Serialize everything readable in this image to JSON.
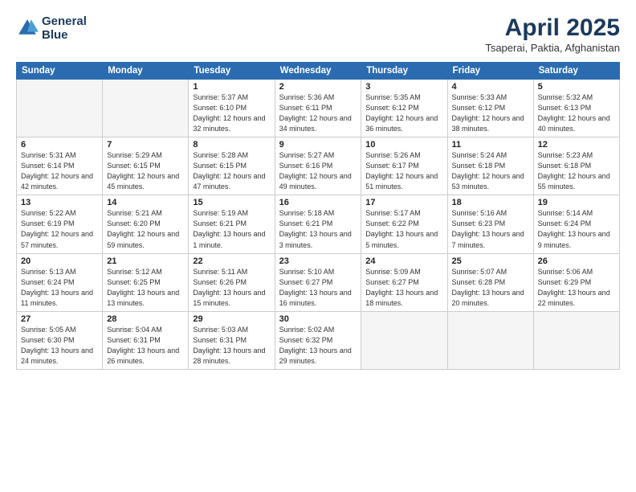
{
  "header": {
    "logo_line1": "General",
    "logo_line2": "Blue",
    "month_title": "April 2025",
    "location": "Tsaperai, Paktia, Afghanistan"
  },
  "days_of_week": [
    "Sunday",
    "Monday",
    "Tuesday",
    "Wednesday",
    "Thursday",
    "Friday",
    "Saturday"
  ],
  "weeks": [
    [
      {
        "day": "",
        "sunrise": "",
        "sunset": "",
        "daylight": ""
      },
      {
        "day": "",
        "sunrise": "",
        "sunset": "",
        "daylight": ""
      },
      {
        "day": "1",
        "sunrise": "Sunrise: 5:37 AM",
        "sunset": "Sunset: 6:10 PM",
        "daylight": "Daylight: 12 hours and 32 minutes."
      },
      {
        "day": "2",
        "sunrise": "Sunrise: 5:36 AM",
        "sunset": "Sunset: 6:11 PM",
        "daylight": "Daylight: 12 hours and 34 minutes."
      },
      {
        "day": "3",
        "sunrise": "Sunrise: 5:35 AM",
        "sunset": "Sunset: 6:12 PM",
        "daylight": "Daylight: 12 hours and 36 minutes."
      },
      {
        "day": "4",
        "sunrise": "Sunrise: 5:33 AM",
        "sunset": "Sunset: 6:12 PM",
        "daylight": "Daylight: 12 hours and 38 minutes."
      },
      {
        "day": "5",
        "sunrise": "Sunrise: 5:32 AM",
        "sunset": "Sunset: 6:13 PM",
        "daylight": "Daylight: 12 hours and 40 minutes."
      }
    ],
    [
      {
        "day": "6",
        "sunrise": "Sunrise: 5:31 AM",
        "sunset": "Sunset: 6:14 PM",
        "daylight": "Daylight: 12 hours and 42 minutes."
      },
      {
        "day": "7",
        "sunrise": "Sunrise: 5:29 AM",
        "sunset": "Sunset: 6:15 PM",
        "daylight": "Daylight: 12 hours and 45 minutes."
      },
      {
        "day": "8",
        "sunrise": "Sunrise: 5:28 AM",
        "sunset": "Sunset: 6:15 PM",
        "daylight": "Daylight: 12 hours and 47 minutes."
      },
      {
        "day": "9",
        "sunrise": "Sunrise: 5:27 AM",
        "sunset": "Sunset: 6:16 PM",
        "daylight": "Daylight: 12 hours and 49 minutes."
      },
      {
        "day": "10",
        "sunrise": "Sunrise: 5:26 AM",
        "sunset": "Sunset: 6:17 PM",
        "daylight": "Daylight: 12 hours and 51 minutes."
      },
      {
        "day": "11",
        "sunrise": "Sunrise: 5:24 AM",
        "sunset": "Sunset: 6:18 PM",
        "daylight": "Daylight: 12 hours and 53 minutes."
      },
      {
        "day": "12",
        "sunrise": "Sunrise: 5:23 AM",
        "sunset": "Sunset: 6:18 PM",
        "daylight": "Daylight: 12 hours and 55 minutes."
      }
    ],
    [
      {
        "day": "13",
        "sunrise": "Sunrise: 5:22 AM",
        "sunset": "Sunset: 6:19 PM",
        "daylight": "Daylight: 12 hours and 57 minutes."
      },
      {
        "day": "14",
        "sunrise": "Sunrise: 5:21 AM",
        "sunset": "Sunset: 6:20 PM",
        "daylight": "Daylight: 12 hours and 59 minutes."
      },
      {
        "day": "15",
        "sunrise": "Sunrise: 5:19 AM",
        "sunset": "Sunset: 6:21 PM",
        "daylight": "Daylight: 13 hours and 1 minute."
      },
      {
        "day": "16",
        "sunrise": "Sunrise: 5:18 AM",
        "sunset": "Sunset: 6:21 PM",
        "daylight": "Daylight: 13 hours and 3 minutes."
      },
      {
        "day": "17",
        "sunrise": "Sunrise: 5:17 AM",
        "sunset": "Sunset: 6:22 PM",
        "daylight": "Daylight: 13 hours and 5 minutes."
      },
      {
        "day": "18",
        "sunrise": "Sunrise: 5:16 AM",
        "sunset": "Sunset: 6:23 PM",
        "daylight": "Daylight: 13 hours and 7 minutes."
      },
      {
        "day": "19",
        "sunrise": "Sunrise: 5:14 AM",
        "sunset": "Sunset: 6:24 PM",
        "daylight": "Daylight: 13 hours and 9 minutes."
      }
    ],
    [
      {
        "day": "20",
        "sunrise": "Sunrise: 5:13 AM",
        "sunset": "Sunset: 6:24 PM",
        "daylight": "Daylight: 13 hours and 11 minutes."
      },
      {
        "day": "21",
        "sunrise": "Sunrise: 5:12 AM",
        "sunset": "Sunset: 6:25 PM",
        "daylight": "Daylight: 13 hours and 13 minutes."
      },
      {
        "day": "22",
        "sunrise": "Sunrise: 5:11 AM",
        "sunset": "Sunset: 6:26 PM",
        "daylight": "Daylight: 13 hours and 15 minutes."
      },
      {
        "day": "23",
        "sunrise": "Sunrise: 5:10 AM",
        "sunset": "Sunset: 6:27 PM",
        "daylight": "Daylight: 13 hours and 16 minutes."
      },
      {
        "day": "24",
        "sunrise": "Sunrise: 5:09 AM",
        "sunset": "Sunset: 6:27 PM",
        "daylight": "Daylight: 13 hours and 18 minutes."
      },
      {
        "day": "25",
        "sunrise": "Sunrise: 5:07 AM",
        "sunset": "Sunset: 6:28 PM",
        "daylight": "Daylight: 13 hours and 20 minutes."
      },
      {
        "day": "26",
        "sunrise": "Sunrise: 5:06 AM",
        "sunset": "Sunset: 6:29 PM",
        "daylight": "Daylight: 13 hours and 22 minutes."
      }
    ],
    [
      {
        "day": "27",
        "sunrise": "Sunrise: 5:05 AM",
        "sunset": "Sunset: 6:30 PM",
        "daylight": "Daylight: 13 hours and 24 minutes."
      },
      {
        "day": "28",
        "sunrise": "Sunrise: 5:04 AM",
        "sunset": "Sunset: 6:31 PM",
        "daylight": "Daylight: 13 hours and 26 minutes."
      },
      {
        "day": "29",
        "sunrise": "Sunrise: 5:03 AM",
        "sunset": "Sunset: 6:31 PM",
        "daylight": "Daylight: 13 hours and 28 minutes."
      },
      {
        "day": "30",
        "sunrise": "Sunrise: 5:02 AM",
        "sunset": "Sunset: 6:32 PM",
        "daylight": "Daylight: 13 hours and 29 minutes."
      },
      {
        "day": "",
        "sunrise": "",
        "sunset": "",
        "daylight": ""
      },
      {
        "day": "",
        "sunrise": "",
        "sunset": "",
        "daylight": ""
      },
      {
        "day": "",
        "sunrise": "",
        "sunset": "",
        "daylight": ""
      }
    ]
  ]
}
